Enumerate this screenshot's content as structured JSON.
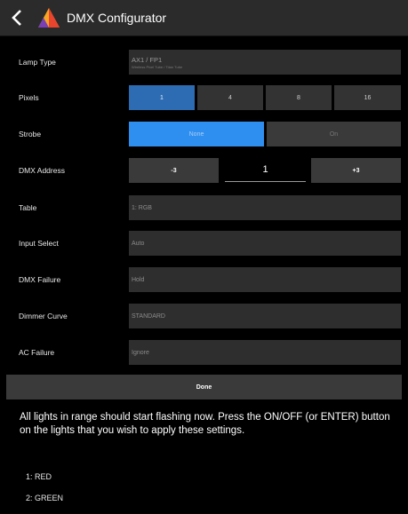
{
  "header": {
    "title": "DMX Configurator"
  },
  "rows": {
    "lamp_type": {
      "label": "Lamp Type",
      "value": "AX1 / FP1",
      "sub": "Wireless Pixel Tube / Titan Tube"
    },
    "pixels": {
      "label": "Pixels",
      "options": [
        "1",
        "4",
        "8",
        "16"
      ],
      "selected": "1"
    },
    "strobe": {
      "label": "Strobe",
      "options": [
        "None",
        "On"
      ],
      "selected": "None"
    },
    "dmx_address": {
      "label": "DMX Address",
      "minus_label": "-3",
      "value": "1",
      "plus_label": "+3"
    },
    "table": {
      "label": "Table",
      "value": "1: RGB"
    },
    "input_select": {
      "label": "Input Select",
      "value": "Auto"
    },
    "dmx_failure": {
      "label": "DMX Failure",
      "value": "Hold"
    },
    "dimmer_curve": {
      "label": "Dimmer Curve",
      "value": "STANDARD"
    },
    "ac_failure": {
      "label": "AC Failure",
      "value": "Ignore"
    }
  },
  "done_label": "Done",
  "message": "All lights in range should start flashing now. Press the ON/OFF (or ENTER) button on the lights that you wish to apply these settings.",
  "lights": [
    "1:  RED",
    "2:  GREEN"
  ],
  "colors": {
    "header_bg": "#2b2b2b",
    "pixel_selected": "#2d6cb3",
    "strobe_selected": "#2f8ff0",
    "field_bg": "#2e2e2e"
  }
}
